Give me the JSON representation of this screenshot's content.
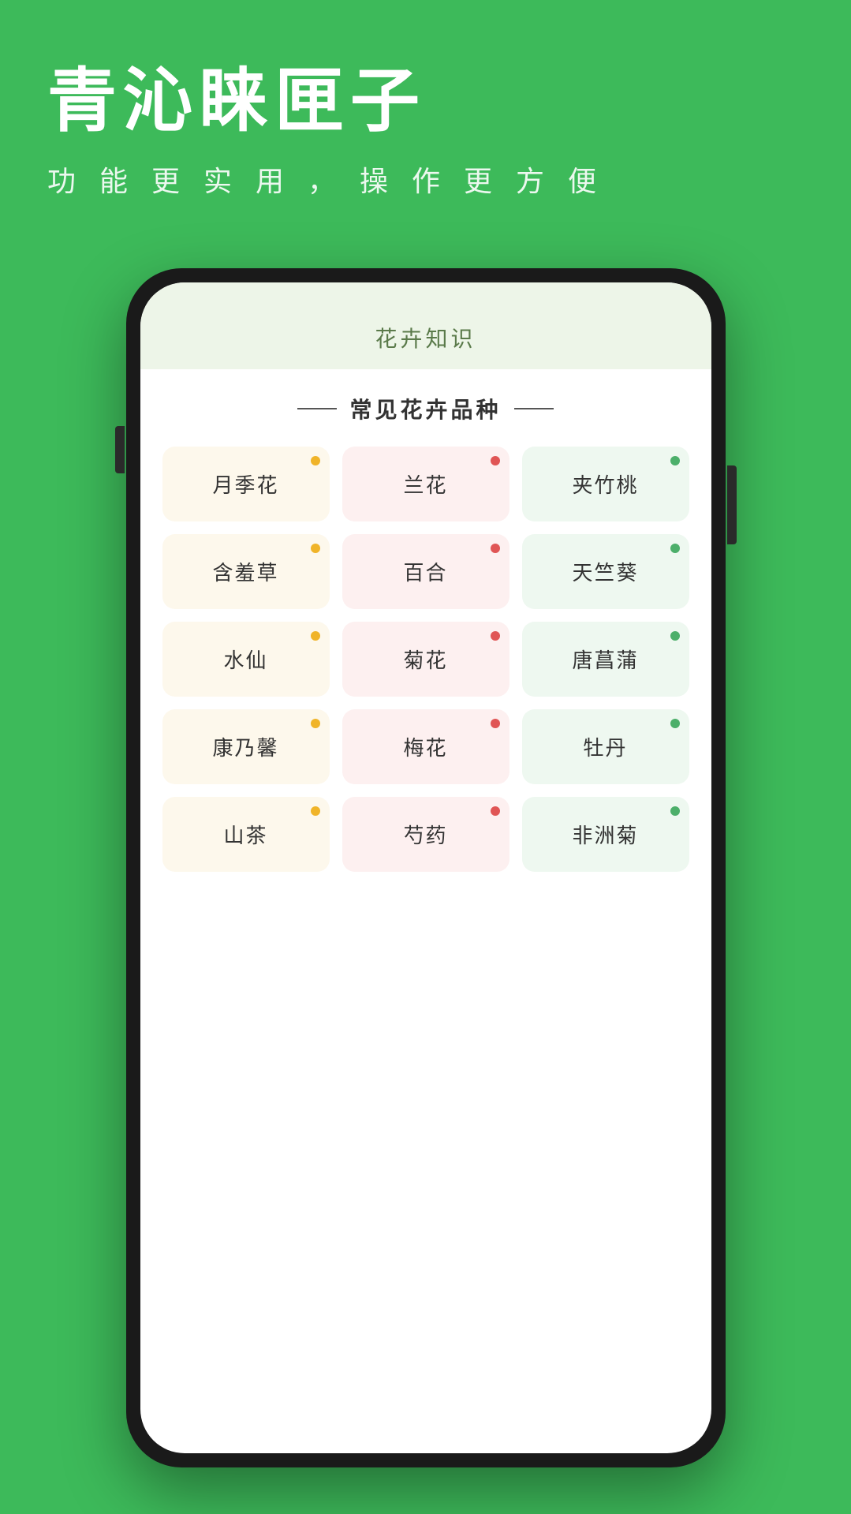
{
  "background_color": "#3dba5a",
  "header": {
    "main_title": "青沁睐匣子",
    "sub_title": "功 能 更 实 用 ， 操 作 更 方 便"
  },
  "phone": {
    "screen_title": "花卉知识",
    "section_title": "常见花卉品种",
    "flowers": [
      {
        "name": "月季花",
        "color": "yellow",
        "dot": "yellow"
      },
      {
        "name": "兰花",
        "color": "pink",
        "dot": "red"
      },
      {
        "name": "夹竹桃",
        "color": "green-card",
        "dot": "green"
      },
      {
        "name": "含羞草",
        "color": "yellow",
        "dot": "yellow"
      },
      {
        "name": "百合",
        "color": "pink",
        "dot": "red"
      },
      {
        "name": "天竺葵",
        "color": "green-card",
        "dot": "green"
      },
      {
        "name": "水仙",
        "color": "yellow",
        "dot": "yellow"
      },
      {
        "name": "菊花",
        "color": "pink",
        "dot": "red"
      },
      {
        "name": "唐菖蒲",
        "color": "green-card",
        "dot": "green"
      },
      {
        "name": "康乃馨",
        "color": "yellow",
        "dot": "yellow"
      },
      {
        "name": "梅花",
        "color": "pink",
        "dot": "red"
      },
      {
        "name": "牡丹",
        "color": "green-card",
        "dot": "green"
      },
      {
        "name": "山茶",
        "color": "yellow",
        "dot": "yellow"
      },
      {
        "name": "芍药",
        "color": "pink",
        "dot": "red"
      },
      {
        "name": "非洲菊",
        "color": "green-card",
        "dot": "green"
      }
    ]
  }
}
